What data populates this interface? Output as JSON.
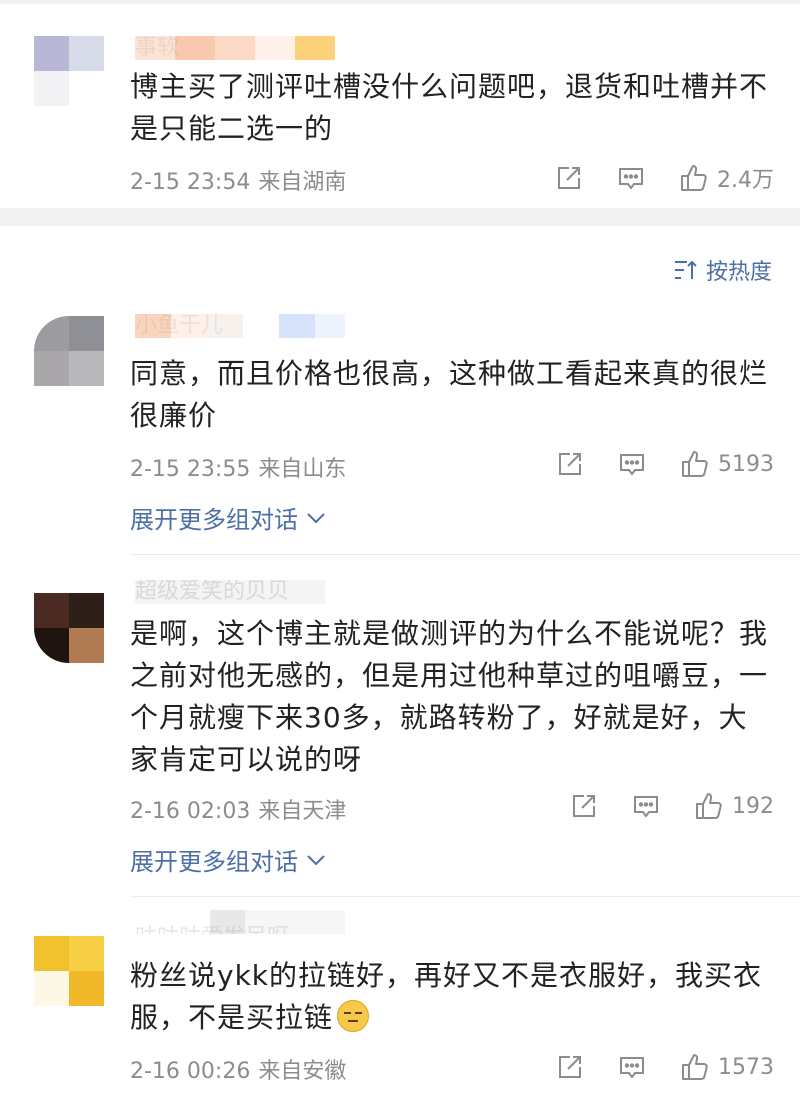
{
  "sort": {
    "label": "按热度",
    "icon": "sort-icon"
  },
  "comments": [
    {
      "username": "事软",
      "text": "博主买了测评吐槽没什么问题吧，退货和吐槽并不是只能二选一的",
      "date": "2-15 23:54",
      "location": "来自湖南",
      "likes": "2.4万",
      "has_expand": false
    },
    {
      "username": "小鱼干儿",
      "text": "同意，而且价格也很高，这种做工看起来真的很烂很廉价",
      "date": "2-15 23:55",
      "location": "来自山东",
      "likes": "5193",
      "has_expand": true
    },
    {
      "username": "超级爱笑的贝贝",
      "text": "是啊，这个博主就是做测评的为什么不能说呢？我之前对他无感的，但是用过他种草过的咀嚼豆，一个月就瘦下来30多，就路转粉了，好就是好，大家肯定可以说的呀",
      "date": "2-16 02:03",
      "location": "来自天津",
      "likes": "192",
      "has_expand": true
    },
    {
      "username": "咕咕咕爱发呆呀",
      "text": "粉丝说ykk的拉链好，再好又不是衣服好，我买衣服，不是买拉链",
      "date": "2-16 00:26",
      "location": "来自安徽",
      "likes": "1573",
      "has_expand": false
    }
  ],
  "expand_label": "展开更多组对话",
  "colors": {
    "link": "#4d6fa8",
    "meta": "#8c8c8c",
    "divider": "#f2f2f2"
  },
  "icons": {
    "share": "share-icon",
    "comment": "comment-icon",
    "like": "like-icon",
    "chevron": "chevron-down-icon",
    "emoji": "grimace-emoji-icon"
  }
}
